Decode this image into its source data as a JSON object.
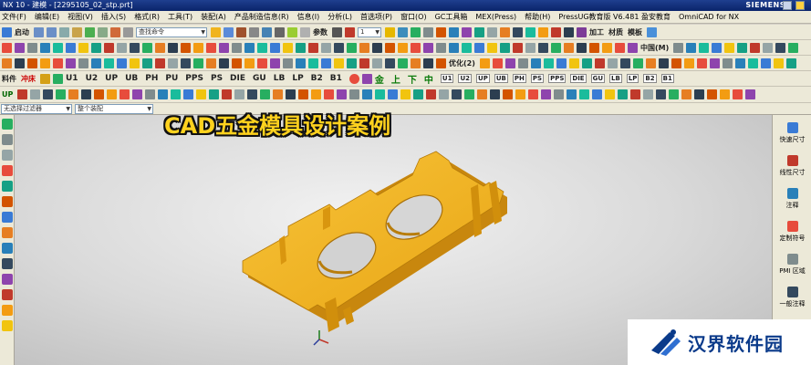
{
  "window": {
    "title": "NX 10 - 建模 - [2295105_02_stp.prt]",
    "brand": "SIEMENS"
  },
  "menu": [
    "文件(F)",
    "编辑(E)",
    "视图(V)",
    "插入(S)",
    "格式(R)",
    "工具(T)",
    "装配(A)",
    "产品制造信息(R)",
    "信息(I)",
    "分析(L)",
    "首选项(P)",
    "窗口(O)",
    "GC工具箱",
    "MEX(Press)",
    "帮助(H)",
    "PressUG教育版 V6.481 盈安教育",
    "OmniCAD for NX"
  ],
  "toolbar": {
    "start_label": "启动",
    "search_placeholder": "查找命令",
    "param_label": "参数",
    "layer_value": "1",
    "machining_label": "加工",
    "material_label": "材质",
    "template_label": "模板",
    "china_label": "中国(M)",
    "optimize_label": "优化(2)",
    "material_short": "料件",
    "punch_label": "冲床",
    "up_label": "UP",
    "plate_labels": [
      "U1",
      "U2",
      "UP",
      "UB",
      "PH",
      "PU",
      "PPS",
      "PS",
      "DIE",
      "GU",
      "LB",
      "LP",
      "B2",
      "B1"
    ],
    "right_plate_labels": [
      "U1",
      "U2",
      "UP",
      "UB",
      "PH",
      "PS",
      "PPS",
      "DIE",
      "GU",
      "LB",
      "LP",
      "B2",
      "B1"
    ],
    "arrow_labels": [
      "金",
      "上",
      "下",
      "中"
    ]
  },
  "filter": {
    "selection_filter": "无选择过滤器",
    "assembly_scope": "整个装配"
  },
  "headline": "CAD五金模具设计案例",
  "right_panel": [
    "快速尺寸",
    "线性尺寸",
    "注释",
    "定制符号",
    "PMI 区域",
    "一般注释"
  ],
  "watermark": {
    "text": "汉界软件园"
  },
  "colors": {
    "part": "#f0b41e",
    "part_shadow": "#c8870e",
    "titlebar": "#0a246a",
    "headline": "#ffd21e"
  }
}
